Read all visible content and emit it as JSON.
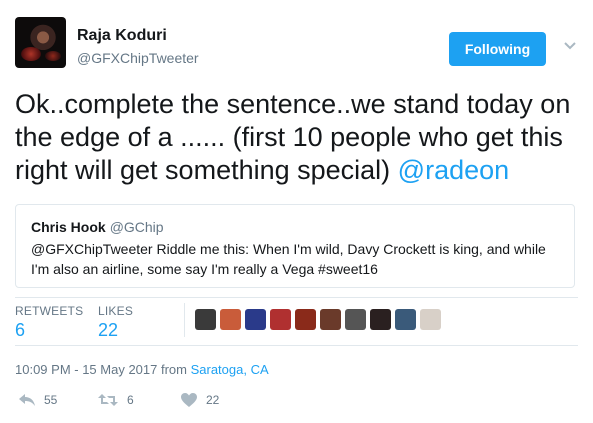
{
  "author": {
    "name": "Raja Koduri",
    "handle": "@GFXChipTweeter"
  },
  "follow_button": "Following",
  "tweet": {
    "text": "Ok..complete the sentence..we stand today on the edge of a ...... (first 10 people who get this right will get something special) ",
    "mention": "@radeon"
  },
  "quote": {
    "name": "Chris Hook",
    "handle": "@GChip",
    "text": "@GFXChipTweeter Riddle me this:  When I'm wild, Davy Crockett is king, and while I'm also an airline, some say I'm really a Vega #sweet16"
  },
  "stats": {
    "retweets_label": "RETWEETS",
    "retweets_value": "6",
    "likes_label": "LIKES",
    "likes_value": "22"
  },
  "likers": [
    {
      "name": "liker-avatar-1",
      "color": "#3a3a3a"
    },
    {
      "name": "liker-avatar-2",
      "color": "#c95c3a"
    },
    {
      "name": "liker-avatar-3",
      "color": "#2a3a8a"
    },
    {
      "name": "liker-avatar-4",
      "color": "#b03030"
    },
    {
      "name": "liker-avatar-5",
      "color": "#8a2a1a"
    },
    {
      "name": "liker-avatar-6",
      "color": "#6a3a2a"
    },
    {
      "name": "liker-avatar-7",
      "color": "#555555"
    },
    {
      "name": "liker-avatar-8",
      "color": "#2a2020"
    },
    {
      "name": "liker-avatar-9",
      "color": "#3a5a7a"
    },
    {
      "name": "liker-avatar-10",
      "color": "#d8d0c8"
    }
  ],
  "timestamp": {
    "text": "10:09 PM - 15 May 2017 from ",
    "location": "Saratoga, CA"
  },
  "actions": {
    "reply_count": "55",
    "retweet_count": "6",
    "like_count": "22"
  },
  "colors": {
    "accent": "#1da1f2",
    "muted": "#657786",
    "border": "#e1e8ed"
  },
  "icons": [
    "chevron-down-icon",
    "reply-icon",
    "retweet-icon",
    "heart-icon"
  ]
}
